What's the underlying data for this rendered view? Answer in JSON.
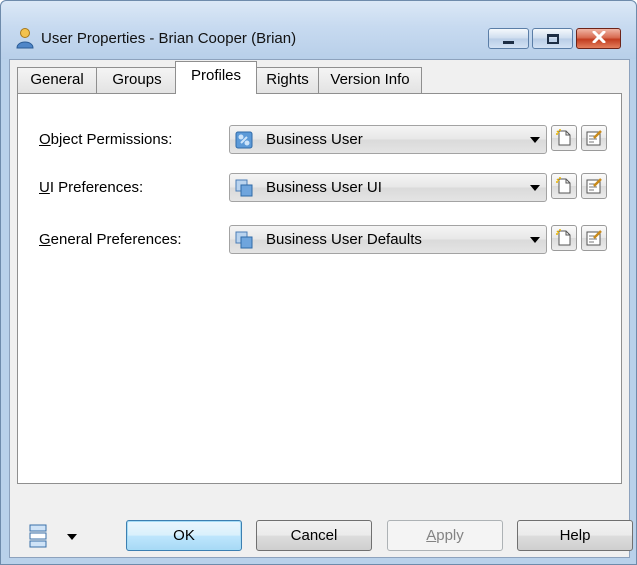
{
  "window": {
    "title": "User Properties - Brian Cooper (Brian)",
    "icon": "user-icon"
  },
  "tabs": [
    {
      "label": "General",
      "active": false
    },
    {
      "label": "Groups",
      "active": false
    },
    {
      "label": "Profiles",
      "active": true
    },
    {
      "label": "Rights",
      "active": false
    },
    {
      "label": "Version Info",
      "active": false
    }
  ],
  "profiles": {
    "object_permissions": {
      "label_key": "O",
      "label_rest": "bject Permissions:",
      "value": "Business User"
    },
    "ui_preferences": {
      "label_key": "U",
      "label_rest": "I Preferences:",
      "value": "Business User UI"
    },
    "general_preferences": {
      "label_key": "G",
      "label_rest": "eneral Preferences:",
      "value": "Business User Defaults"
    }
  },
  "buttons": {
    "ok": "OK",
    "cancel": "Cancel",
    "apply_key": "A",
    "apply_rest": "pply",
    "help": "Help"
  },
  "colors": {
    "titlebar": "#c7daf0",
    "close_button": "#c23d20",
    "default_button_border": "#3c7fb1"
  }
}
